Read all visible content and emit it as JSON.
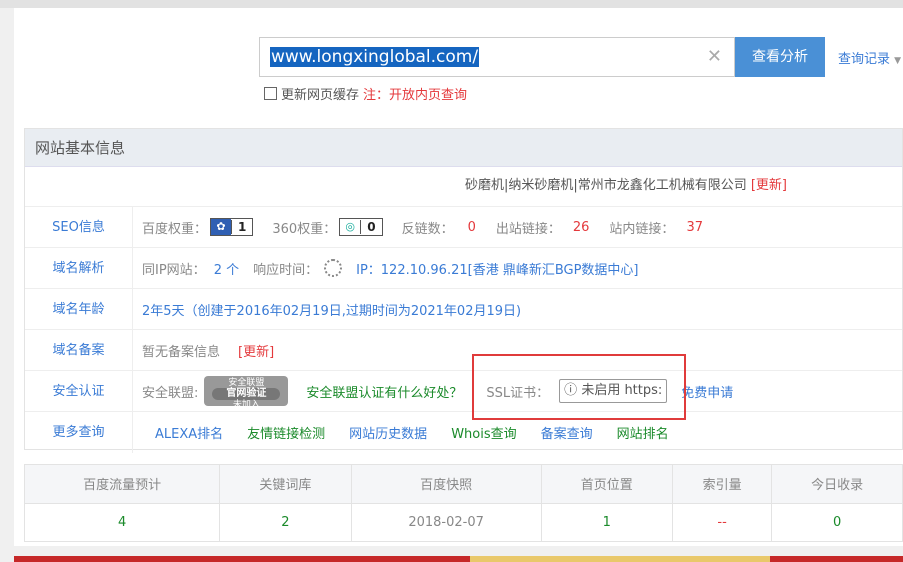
{
  "search": {
    "value": "www.longxinglobal.com/",
    "button": "查看分析",
    "history": "查询记录",
    "cache_label": "更新网页缓存",
    "cache_note": "注：开放内页查询"
  },
  "panel": {
    "title": "网站基本信息",
    "site_title": "砂磨机|纳米砂磨机|常州市龙鑫化工机械有限公司",
    "update": "[更新]"
  },
  "seo": {
    "label": "SEO信息",
    "baidu_label": "百度权重：",
    "baidu_value": "1",
    "w360_label": "360权重：",
    "w360_value": "0",
    "backlinks_label": "反链数：",
    "backlinks_value": "0",
    "outlinks_label": "出站链接：",
    "outlinks_value": "26",
    "inlinks_label": "站内链接：",
    "inlinks_value": "37"
  },
  "dns": {
    "label": "域名解析",
    "sameip_label": "同IP网站：",
    "sameip_value": "2 个",
    "resp_label": "响应时间：",
    "ip": "IP：122.10.96.21[香港 鼎峰新汇BGP数据中心]"
  },
  "age": {
    "label": "域名年龄",
    "value": "2年5天（创建于2016年02月19日,过期时间为2021年02月19日)"
  },
  "icp": {
    "label": "域名备案",
    "value": "暂无备案信息",
    "update": "[更新]"
  },
  "security": {
    "label": "安全认证",
    "alliance_label": "安全联盟:",
    "seal_top": "安全联盟",
    "seal_main": "官网验证",
    "seal_sub": "未加入",
    "alliance_link": "安全联盟认证有什么好处？",
    "ssl_label": "SSL证书：",
    "ssl_btn": "未启用 https:",
    "ssl_apply": "免费申请"
  },
  "more": {
    "label": "更多查询",
    "links": [
      "ALEXA排名",
      "友情链接检测",
      "网站历史数据",
      "Whois查询",
      "备案查询",
      "网站排名"
    ]
  },
  "stats": {
    "headers": [
      "百度流量预计",
      "关键词库",
      "百度快照",
      "首页位置",
      "索引量",
      "今日收录"
    ],
    "values": [
      "4",
      "2",
      "2018-02-07",
      "1",
      "--",
      "0"
    ]
  }
}
